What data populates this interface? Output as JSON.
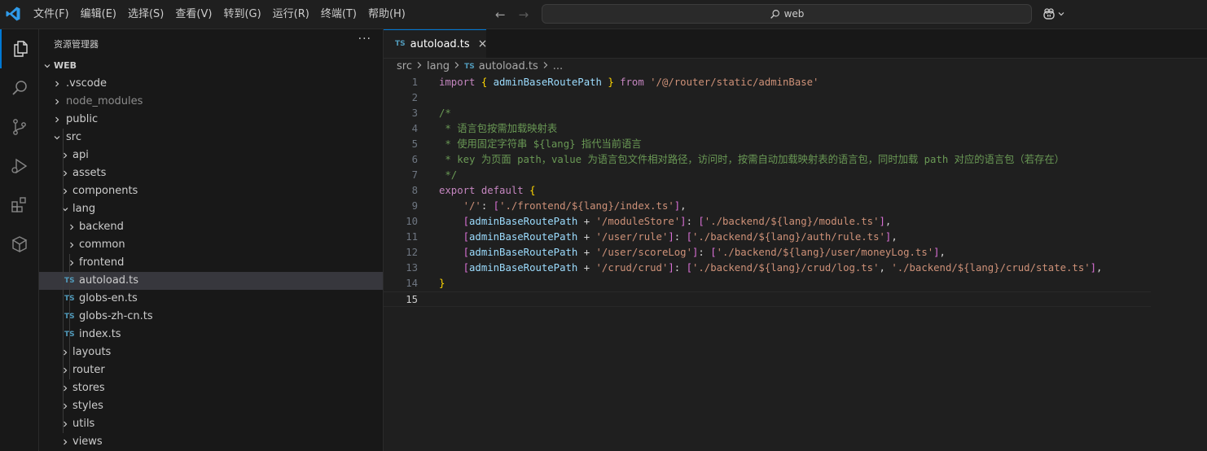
{
  "menu": [
    "文件(F)",
    "编辑(E)",
    "选择(S)",
    "查看(V)",
    "转到(G)",
    "运行(R)",
    "终端(T)",
    "帮助(H)"
  ],
  "search": {
    "value": "web"
  },
  "sidebar": {
    "title": "资源管理器",
    "more": "···",
    "root": "WEB",
    "tree": [
      {
        "label": ".vscode",
        "depth": 1,
        "type": "folder",
        "expanded": false
      },
      {
        "label": "node_modules",
        "depth": 1,
        "type": "folder",
        "expanded": false,
        "dim": true
      },
      {
        "label": "public",
        "depth": 1,
        "type": "folder",
        "expanded": false
      },
      {
        "label": "src",
        "depth": 1,
        "type": "folder",
        "expanded": true
      },
      {
        "label": "api",
        "depth": 2,
        "type": "folder",
        "expanded": false
      },
      {
        "label": "assets",
        "depth": 2,
        "type": "folder",
        "expanded": false
      },
      {
        "label": "components",
        "depth": 2,
        "type": "folder",
        "expanded": false
      },
      {
        "label": "lang",
        "depth": 2,
        "type": "folder",
        "expanded": true
      },
      {
        "label": "backend",
        "depth": 3,
        "type": "folder",
        "expanded": false
      },
      {
        "label": "common",
        "depth": 3,
        "type": "folder",
        "expanded": false
      },
      {
        "label": "frontend",
        "depth": 3,
        "type": "folder",
        "expanded": false
      },
      {
        "label": "autoload.ts",
        "depth": 3,
        "type": "ts",
        "selected": true
      },
      {
        "label": "globs-en.ts",
        "depth": 3,
        "type": "ts"
      },
      {
        "label": "globs-zh-cn.ts",
        "depth": 3,
        "type": "ts"
      },
      {
        "label": "index.ts",
        "depth": 3,
        "type": "ts"
      },
      {
        "label": "layouts",
        "depth": 2,
        "type": "folder",
        "expanded": false
      },
      {
        "label": "router",
        "depth": 2,
        "type": "folder",
        "expanded": false
      },
      {
        "label": "stores",
        "depth": 2,
        "type": "folder",
        "expanded": false
      },
      {
        "label": "styles",
        "depth": 2,
        "type": "folder",
        "expanded": false
      },
      {
        "label": "utils",
        "depth": 2,
        "type": "folder",
        "expanded": false
      },
      {
        "label": "views",
        "depth": 2,
        "type": "folder",
        "expanded": false
      }
    ]
  },
  "editor": {
    "tab": {
      "icon": "TS",
      "name": "autoload.ts",
      "close": "×"
    },
    "breadcrumb": [
      "src",
      "lang",
      "autoload.ts",
      "..."
    ],
    "ts_badge": "TS",
    "current_line": 15,
    "lines": [
      [
        [
          "kw2",
          "import"
        ],
        [
          "pn",
          " "
        ],
        [
          "b1",
          "{"
        ],
        [
          "pn",
          " "
        ],
        [
          "id",
          "adminBaseRoutePath"
        ],
        [
          "pn",
          " "
        ],
        [
          "b1",
          "}"
        ],
        [
          "pn",
          " "
        ],
        [
          "kw2",
          "from"
        ],
        [
          "pn",
          " "
        ],
        [
          "str",
          "'/@/router/static/adminBase'"
        ]
      ],
      [],
      [
        [
          "cm",
          "/*"
        ]
      ],
      [
        [
          "cm",
          " * 语言包按需加载映射表"
        ]
      ],
      [
        [
          "cm",
          " * 使用固定字符串 ${lang} 指代当前语言"
        ]
      ],
      [
        [
          "cm",
          " * key 为页面 path，value 为语言包文件相对路径，访问时，按需自动加载映射表的语言包，同时加载 path 对应的语言包（若存在）"
        ]
      ],
      [
        [
          "cm",
          " */"
        ]
      ],
      [
        [
          "kw2",
          "export"
        ],
        [
          "pn",
          " "
        ],
        [
          "kw2",
          "default"
        ],
        [
          "pn",
          " "
        ],
        [
          "b1",
          "{"
        ]
      ],
      [
        [
          "pn",
          "    "
        ],
        [
          "str",
          "'/'"
        ],
        [
          "pn",
          ": "
        ],
        [
          "b2",
          "["
        ],
        [
          "str",
          "'./frontend/${lang}/index.ts'"
        ],
        [
          "b2",
          "]"
        ],
        [
          "pn",
          ","
        ]
      ],
      [
        [
          "pn",
          "    "
        ],
        [
          "b2",
          "["
        ],
        [
          "id",
          "adminBaseRoutePath"
        ],
        [
          "pn",
          " + "
        ],
        [
          "str",
          "'/moduleStore'"
        ],
        [
          "b2",
          "]"
        ],
        [
          "pn",
          ": "
        ],
        [
          "b2",
          "["
        ],
        [
          "str",
          "'./backend/${lang}/module.ts'"
        ],
        [
          "b2",
          "]"
        ],
        [
          "pn",
          ","
        ]
      ],
      [
        [
          "pn",
          "    "
        ],
        [
          "b2",
          "["
        ],
        [
          "id",
          "adminBaseRoutePath"
        ],
        [
          "pn",
          " + "
        ],
        [
          "str",
          "'/user/rule'"
        ],
        [
          "b2",
          "]"
        ],
        [
          "pn",
          ": "
        ],
        [
          "b2",
          "["
        ],
        [
          "str",
          "'./backend/${lang}/auth/rule.ts'"
        ],
        [
          "b2",
          "]"
        ],
        [
          "pn",
          ","
        ]
      ],
      [
        [
          "pn",
          "    "
        ],
        [
          "b2",
          "["
        ],
        [
          "id",
          "adminBaseRoutePath"
        ],
        [
          "pn",
          " + "
        ],
        [
          "str",
          "'/user/scoreLog'"
        ],
        [
          "b2",
          "]"
        ],
        [
          "pn",
          ": "
        ],
        [
          "b2",
          "["
        ],
        [
          "str",
          "'./backend/${lang}/user/moneyLog.ts'"
        ],
        [
          "b2",
          "]"
        ],
        [
          "pn",
          ","
        ]
      ],
      [
        [
          "pn",
          "    "
        ],
        [
          "b2",
          "["
        ],
        [
          "id",
          "adminBaseRoutePath"
        ],
        [
          "pn",
          " + "
        ],
        [
          "str",
          "'/crud/crud'"
        ],
        [
          "b2",
          "]"
        ],
        [
          "pn",
          ": "
        ],
        [
          "b2",
          "["
        ],
        [
          "str",
          "'./backend/${lang}/crud/log.ts'"
        ],
        [
          "pn",
          ", "
        ],
        [
          "str",
          "'./backend/${lang}/crud/state.ts'"
        ],
        [
          "b2",
          "]"
        ],
        [
          "pn",
          ","
        ]
      ],
      [
        [
          "b1",
          "}"
        ]
      ],
      []
    ]
  },
  "colors": {
    "accent": "#0078d4",
    "ts_icon": "#519aba"
  }
}
